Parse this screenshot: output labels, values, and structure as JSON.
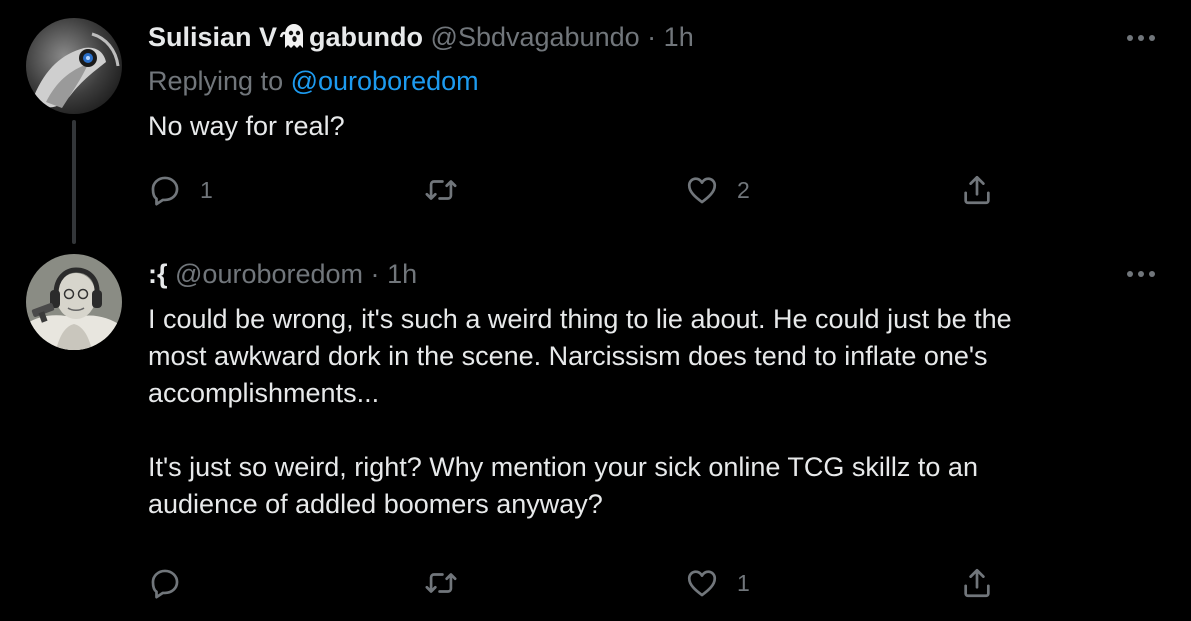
{
  "tweets": [
    {
      "display_name_start": "Sulisian V",
      "display_name_end": "gabundo",
      "handle": "@Sbdvagabundo",
      "separator": "·",
      "time": "1h",
      "replying_prefix": "Replying to",
      "replying_to": "@ouroboredom",
      "text": "No way for real?",
      "reply_count": "1",
      "retweet_count": "",
      "like_count": "2"
    },
    {
      "display_name": ":{",
      "handle": "@ouroboredom",
      "separator": "·",
      "time": "1h",
      "text": "I could be wrong, it's such a weird thing to lie about. He could just be the\nmost awkward dork in the scene. Narcissism does tend to inflate one's\naccomplishments...\n\nIt's just so weird, right? Why mention your sick online TCG skillz to an\naudience of addled boomers anyway?",
      "reply_count": "",
      "retweet_count": "",
      "like_count": "1"
    }
  ],
  "icons": {
    "reply": "reply-icon",
    "retweet": "retweet-icon",
    "like": "heart-icon",
    "share": "share-icon",
    "more": "more-icon",
    "ghost": "ghost-icon"
  },
  "colors": {
    "background": "#000000",
    "text": "#e7e9ea",
    "muted": "#71767b",
    "link": "#1d9bf0",
    "thread_line": "#333639"
  }
}
